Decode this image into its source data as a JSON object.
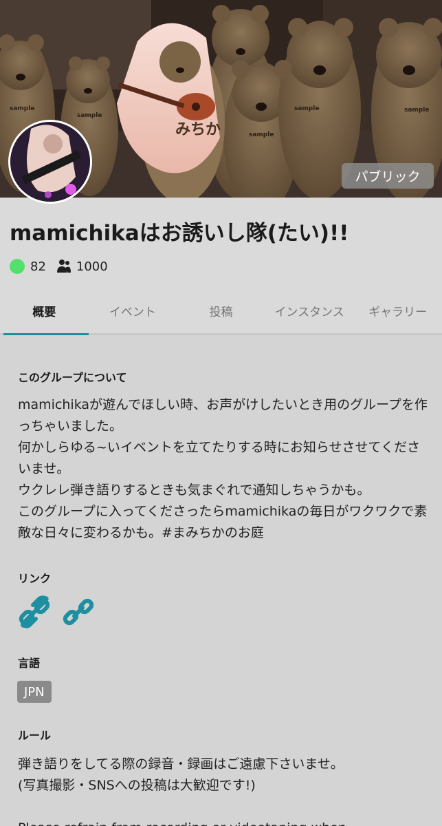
{
  "banner": {
    "visibility_badge": "パブリック",
    "shirt_text": "みちか",
    "sample_label": "sample"
  },
  "group": {
    "title": "mamichikaはお誘いし隊(たい)!!",
    "online_count": "82",
    "member_count": "1000"
  },
  "tabs": [
    {
      "label": "概要",
      "active": true
    },
    {
      "label": "イベント",
      "active": false
    },
    {
      "label": "投稿",
      "active": false
    },
    {
      "label": "インスタンス",
      "active": false
    },
    {
      "label": "ギャラリー",
      "active": false
    }
  ],
  "about": {
    "heading": "このグループについて",
    "body": "mamichikaが遊んでほしい時、お声がけしたいとき用のグループを作っちゃいました。\n何かしらゆる~いイベントを立てたりする時にお知らせさせてくださいませ。\nウクレレ弾き語りするときも気まぐれで通知しちゃうかも。\nこのグループに入ってくださったらmamichikaの毎日がワクワクで素敵な日々に変わるかも。#まみちかのお庭"
  },
  "links": {
    "heading": "リンク",
    "icons": [
      "link-icon",
      "link-icon"
    ]
  },
  "language": {
    "heading": "言語",
    "value": "JPN"
  },
  "rules": {
    "heading": "ルール",
    "body": "弾き語りをしてる際の録音・録画はご遠慮下さいませ。\n(写真撮影・SNSへの投稿は大歓迎です!)\n\nPlease refrain from recording or videotaping when"
  },
  "colors": {
    "online": "#54e06d",
    "accent": "#1e8fa0",
    "link_icon": "#1e8fa0",
    "badge_bg": "#8a8a8a"
  }
}
